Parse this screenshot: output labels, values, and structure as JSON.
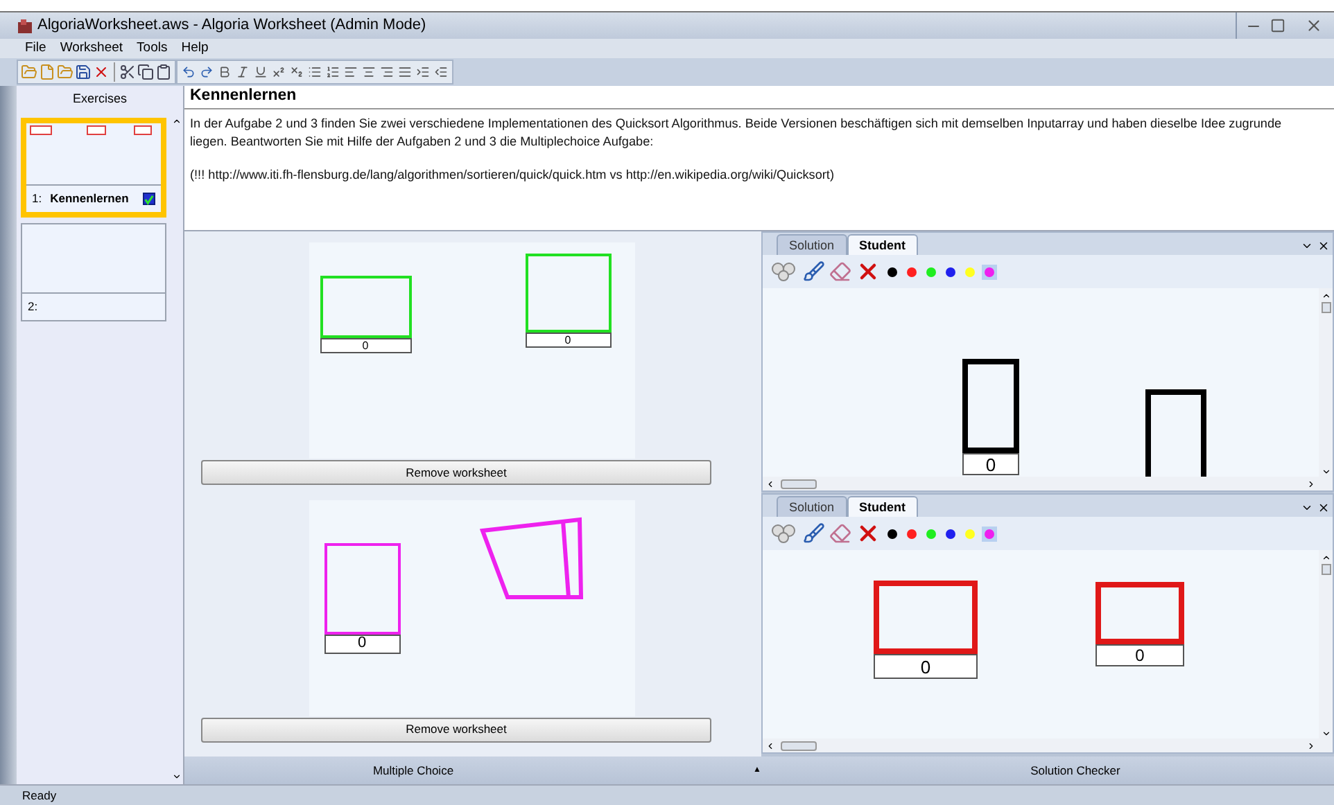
{
  "window": {
    "title": "AlgoriaWorksheet.aws - Algoria Worksheet (Admin Mode)"
  },
  "menu": [
    "File",
    "Worksheet",
    "Tools",
    "Help"
  ],
  "sidebar": {
    "title": "Exercises",
    "items": [
      {
        "number": "1:",
        "title": "Kennenlernen",
        "selected": true,
        "checked": true
      },
      {
        "number": "2:",
        "selected": false
      }
    ]
  },
  "exercise": {
    "title": "Kennenlernen",
    "paragraphs": [
      "In der Aufgabe 2 und 3 finden Sie zwei verschiedene Implementationen des Quicksort Algorithmus. Beide Versionen beschäftigen sich mit demselben Inputarray und haben dieselbe Idee zugrunde liegen. Beantworten Sie mit Hilfe der Aufgaben 2 und 3 die Multiplechoice Aufgabe:",
      "(!!! http://www.iti.fh-flensburg.de/lang/algorithmen/sortieren/quick/quick.htm vs http://en.wikipedia.org/wiki/Quicksort)"
    ]
  },
  "worksheets": [
    {
      "shapes": [
        {
          "kind": "box",
          "color": "#22e022",
          "label": "0"
        },
        {
          "kind": "box",
          "color": "#22e022",
          "label": "0"
        }
      ],
      "button": "Remove worksheet"
    },
    {
      "shapes": [
        {
          "kind": "box",
          "color": "#ee22ee",
          "label": "0"
        },
        {
          "kind": "polygon",
          "color": "#ee22ee"
        }
      ],
      "button": "Remove worksheet"
    }
  ],
  "student_panels": [
    {
      "tabs": [
        {
          "label": "Solution",
          "selected": false
        },
        {
          "label": "Student",
          "selected": true
        }
      ],
      "palette": [
        {
          "color": "#000000",
          "selected": false
        },
        {
          "color": "#ff2020",
          "selected": false
        },
        {
          "color": "#20ee20",
          "selected": false
        },
        {
          "color": "#2020ee",
          "selected": false
        },
        {
          "color": "#ffff20",
          "selected": false
        },
        {
          "color": "#ee20ee",
          "selected": true
        }
      ],
      "shapes": [
        {
          "kind": "box",
          "color": "#000000",
          "label": "0"
        },
        {
          "kind": "box",
          "color": "#000000"
        }
      ]
    },
    {
      "tabs": [
        {
          "label": "Solution",
          "selected": false
        },
        {
          "label": "Student",
          "selected": true
        }
      ],
      "palette": [
        {
          "color": "#000000",
          "selected": false
        },
        {
          "color": "#ff2020",
          "selected": false
        },
        {
          "color": "#20ee20",
          "selected": false
        },
        {
          "color": "#2020ee",
          "selected": false
        },
        {
          "color": "#ffff20",
          "selected": false
        },
        {
          "color": "#ee20ee",
          "selected": true
        }
      ],
      "shapes": [
        {
          "kind": "box",
          "color": "#e01818",
          "label": "0"
        },
        {
          "kind": "box",
          "color": "#e01818",
          "label": "0"
        }
      ]
    }
  ],
  "bottom_bar": {
    "left": "Multiple Choice",
    "toggle": "▲",
    "right": "Solution Checker"
  },
  "status_bar": "Ready"
}
